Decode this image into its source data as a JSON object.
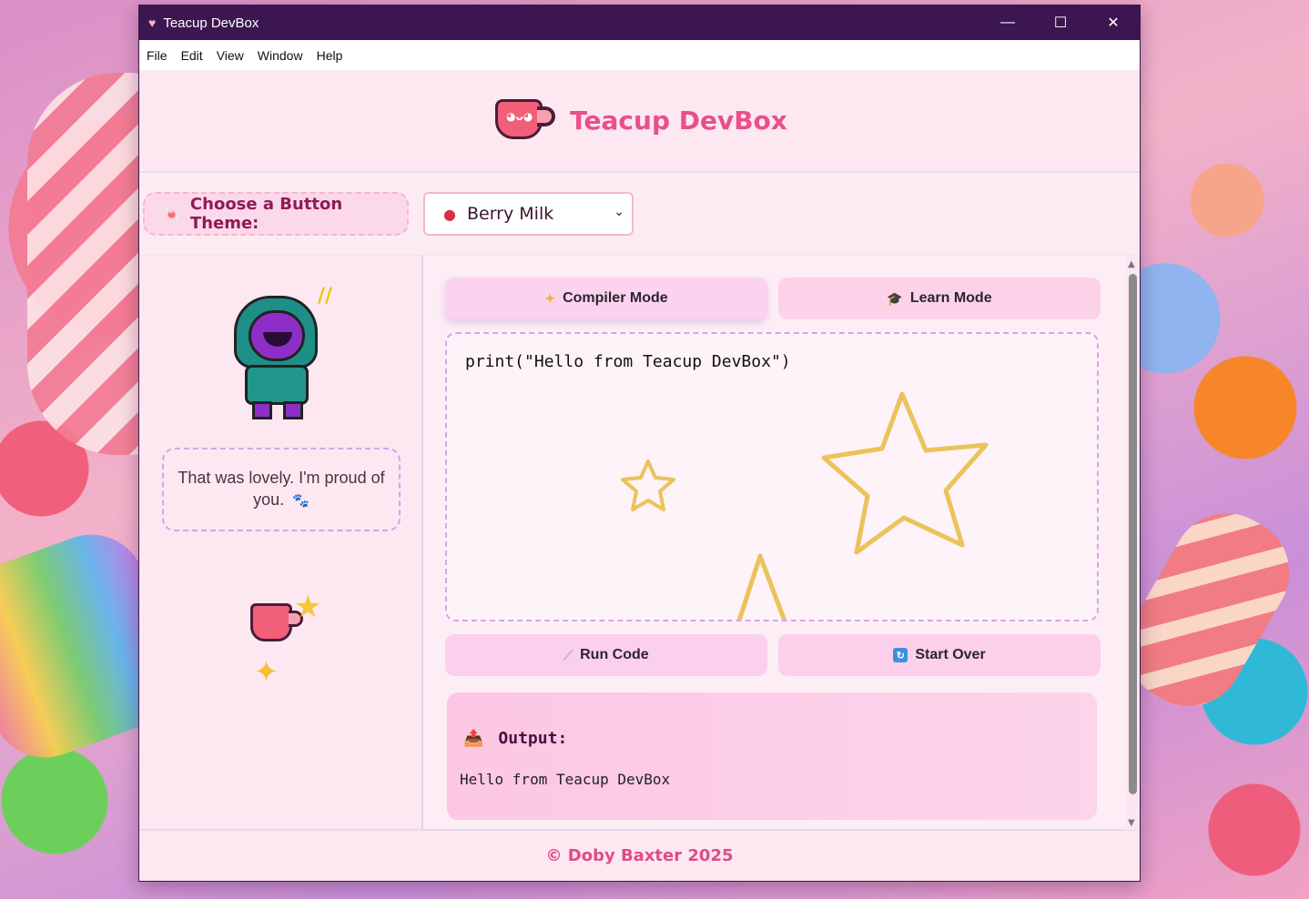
{
  "window": {
    "title": "Teacup DevBox",
    "controls": {
      "minimize": "—",
      "maximize": "☐",
      "close": "✕"
    }
  },
  "menu": [
    "File",
    "Edit",
    "View",
    "Window",
    "Help"
  ],
  "header": {
    "title": "Teacup DevBox",
    "logo_icon": "teacup-icon"
  },
  "theme": {
    "label": "Choose a Button Theme:",
    "label_icon": "candy-icon",
    "selected": "Berry Milk",
    "selected_icon": "strawberry-icon"
  },
  "companion": {
    "message": "That was lovely. I'm proud of you.",
    "message_icon": "paw-icon",
    "mascot_icon": "hooded-character-icon",
    "decor_icons": [
      "teacup-star-icon",
      "sparkles-icon"
    ]
  },
  "modes": {
    "compiler": {
      "label": "Compiler Mode",
      "icon": "sparkle-icon"
    },
    "learn": {
      "label": "Learn Mode",
      "icon": "graduation-cap-icon"
    }
  },
  "editor": {
    "code": "print(\"Hello from Teacup DevBox\")"
  },
  "actions": {
    "run": {
      "label": "Run Code",
      "icon": "wand-icon"
    },
    "start_over": {
      "label": "Start Over",
      "icon": "refresh-icon"
    }
  },
  "output": {
    "title": "Output:",
    "icon": "outbox-icon",
    "text": "Hello from Teacup DevBox"
  },
  "footer": {
    "text": "© Doby Baxter 2025"
  },
  "colors": {
    "titlebar": "#3c1651",
    "accent": "#e8508b",
    "button_bg": "#fbd0ec",
    "star": "#ecc25a"
  }
}
